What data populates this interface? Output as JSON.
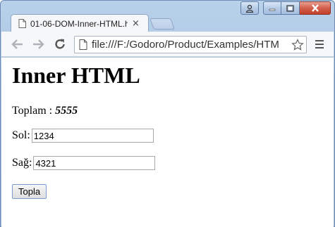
{
  "browser": {
    "tab_title": "01-06-DOM-Inner-HTML.h",
    "tab_close": "×",
    "url": "file:///F:/Godoro/Product/Examples/HTM"
  },
  "page": {
    "heading": "Inner HTML",
    "total_label": "Toplam : ",
    "total_value": "5555",
    "left_label": "Sol: ",
    "left_value": "1234",
    "right_label": "Sağ: ",
    "right_value": "4321",
    "button_label": "Topla"
  },
  "icons": {
    "tab": "page-icon",
    "back": "arrow-left-icon",
    "forward": "arrow-right-icon",
    "reload": "reload-icon",
    "omnibox": "file-icon",
    "bookmark": "star-icon",
    "menu": "hamburger-menu-icon",
    "window_user": "user-icon",
    "window_minimize": "minimize-icon",
    "window_maximize": "maximize-icon",
    "window_close": "close-icon"
  }
}
